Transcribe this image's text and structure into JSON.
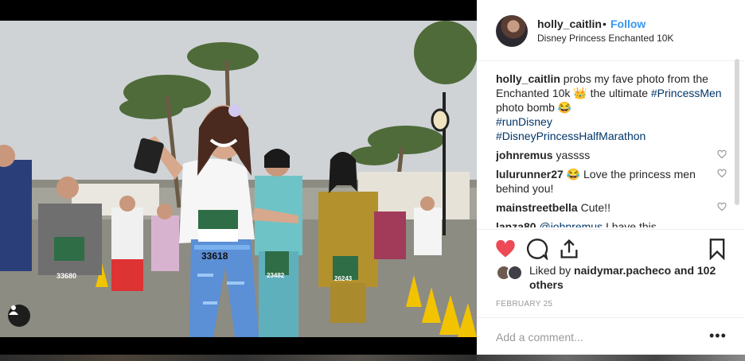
{
  "post": {
    "username": "holly_caitlin",
    "separator": "•",
    "follow_label": "Follow",
    "location": "Disney Princess Enchanted 10K",
    "caption": {
      "username": "holly_caitlin",
      "text_1": " probs my fave photo from the Enchanted 10k ",
      "emoji_1": "👑",
      "text_2": " the ultimate ",
      "tag_1": "#PrincessMen",
      "text_3": " photo bomb ",
      "emoji_2": "😂",
      "tag_2": "#runDisney",
      "tag_3": "#DisneyPrincessHalfMarathon"
    },
    "comments": [
      {
        "username": "johnremus",
        "text": " yassss"
      },
      {
        "username": "lulurunner27",
        "text": " 😂 Love the princess men behind you!"
      },
      {
        "username": "mainstreetbella",
        "text": " Cute!!"
      },
      {
        "username": "lanza80",
        "mention": " @johnremus",
        "text": " I have this"
      }
    ],
    "likes": {
      "prefix": "Liked by ",
      "liked_by": "naidymar.pacheco",
      "suffix": " and 102 others"
    },
    "date": "FEBRUARY 25",
    "add_comment_placeholder": "Add a comment...",
    "more_options": "•••",
    "photo_bibs": [
      "33618",
      "33680",
      "23482",
      "26243"
    ],
    "colors": {
      "like_red": "#ed4956",
      "follow_blue": "#3897f0",
      "hashtag": "#003569",
      "text": "#262626",
      "muted": "#999999"
    },
    "icons": [
      "heart-icon",
      "comment-icon",
      "share-icon",
      "bookmark-icon",
      "user-tag-icon",
      "more-options-icon"
    ]
  }
}
